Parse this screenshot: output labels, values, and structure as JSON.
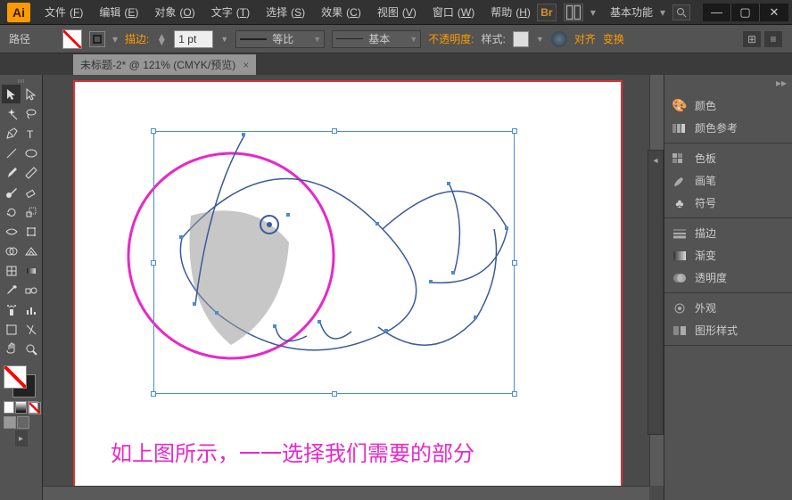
{
  "titlebar": {
    "logo": "Ai",
    "menus": [
      {
        "label": "文件",
        "key": "F"
      },
      {
        "label": "编辑",
        "key": "E"
      },
      {
        "label": "对象",
        "key": "O"
      },
      {
        "label": "文字",
        "key": "T"
      },
      {
        "label": "选择",
        "key": "S"
      },
      {
        "label": "效果",
        "key": "C"
      },
      {
        "label": "视图",
        "key": "V"
      },
      {
        "label": "窗口",
        "key": "W"
      },
      {
        "label": "帮助",
        "key": "H"
      }
    ],
    "bridge": "Br",
    "workspace_label": "基本功能"
  },
  "optbar": {
    "context": "路径",
    "stroke_label": "描边:",
    "stroke_val": "1 pt",
    "uniform": "等比",
    "basic": "基本",
    "opacity": "不透明度:",
    "style": "样式:",
    "align": "对齐",
    "transform": "变换"
  },
  "tab": {
    "title": "未标题-2* @ 121% (CMYK/预览)",
    "close": "×"
  },
  "panels": {
    "g1": [
      {
        "n": "颜色",
        "id": "color"
      },
      {
        "n": "颜色参考",
        "id": "color-guide"
      }
    ],
    "g2": [
      {
        "n": "色板",
        "id": "swatches"
      },
      {
        "n": "画笔",
        "id": "brushes"
      },
      {
        "n": "符号",
        "id": "symbols"
      }
    ],
    "g3": [
      {
        "n": "描边",
        "id": "stroke"
      },
      {
        "n": "渐变",
        "id": "gradient"
      },
      {
        "n": "透明度",
        "id": "transparency"
      }
    ],
    "g4": [
      {
        "n": "外观",
        "id": "appearance"
      },
      {
        "n": "图形样式",
        "id": "graphic-styles"
      }
    ]
  },
  "canvas": {
    "annotation": "如上图所示，一一选择我们需要的部分"
  }
}
